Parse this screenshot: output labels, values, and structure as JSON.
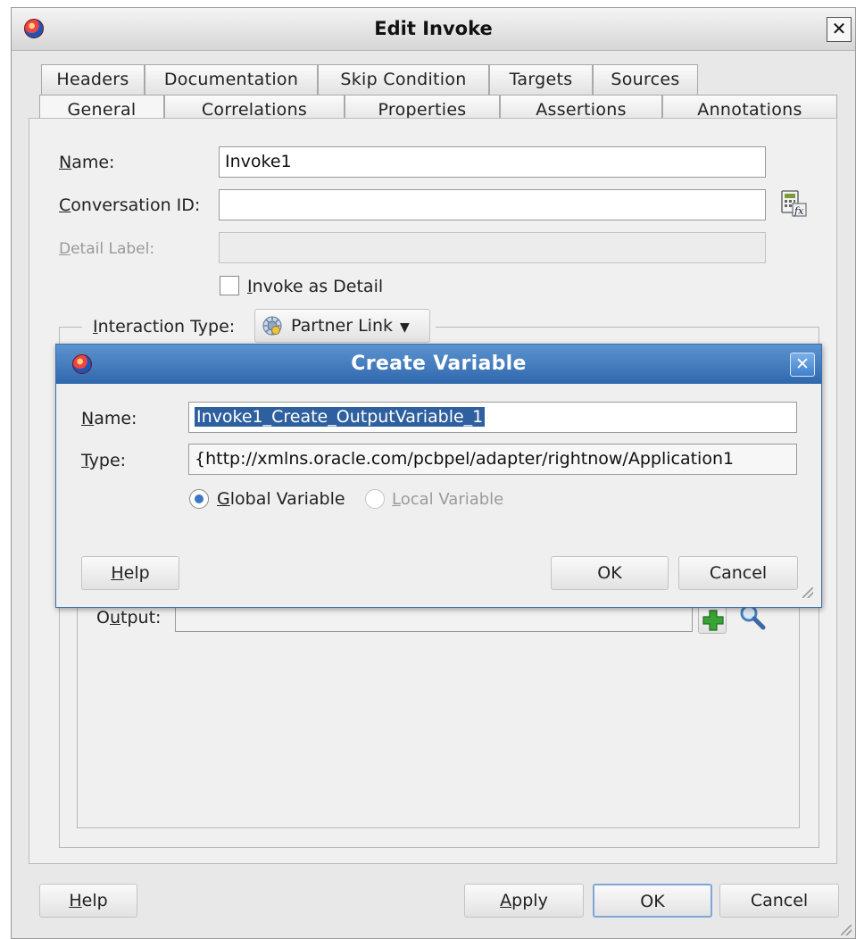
{
  "window": {
    "title": "Edit Invoke"
  },
  "tabs_row1": [
    "Headers",
    "Documentation",
    "Skip Condition",
    "Targets",
    "Sources"
  ],
  "tabs_row2": [
    "General",
    "Correlations",
    "Properties",
    "Assertions",
    "Annotations"
  ],
  "active_tab": "General",
  "form": {
    "name_label_u": "N",
    "name_label_rest": "ame:",
    "name_value": "Invoke1",
    "conversation_label_u": "C",
    "conversation_label_rest": "onversation ID:",
    "conversation_value": "",
    "detail_label_u": "D",
    "detail_label_rest": "etail Label:",
    "detail_value": "",
    "invoke_detail_u": "I",
    "invoke_detail_rest": "nvoke as Detail",
    "invoke_detail_checked": false,
    "interaction_label_u": "I",
    "interaction_label_rest": "nteraction Type:",
    "interaction_value": "Partner Link",
    "output_label_pre": "O",
    "output_label_u": "u",
    "output_label_rest": "tput:",
    "output_value": ""
  },
  "footer": {
    "help_u": "H",
    "help_rest": "elp",
    "apply_u": "A",
    "apply_rest": "pply",
    "ok": "OK",
    "cancel": "Cancel"
  },
  "dialog": {
    "title": "Create Variable",
    "name_label_u": "N",
    "name_label_rest": "ame:",
    "name_value": "Invoke1_Create_OutputVariable_1",
    "type_label_u": "T",
    "type_label_rest": "ype:",
    "type_value": "{http://xmlns.oracle.com/pcbpel/adapter/rightnow/Application1",
    "global_u": "G",
    "global_rest": "lobal Variable",
    "local_u": "L",
    "local_rest": "ocal Variable",
    "selected_scope": "Global Variable",
    "help_u": "H",
    "help_rest": "elp",
    "ok": "OK",
    "cancel": "Cancel"
  },
  "colors": {
    "dialog_title_bar": "#2f68ad",
    "selection": "#2e5f9e"
  }
}
